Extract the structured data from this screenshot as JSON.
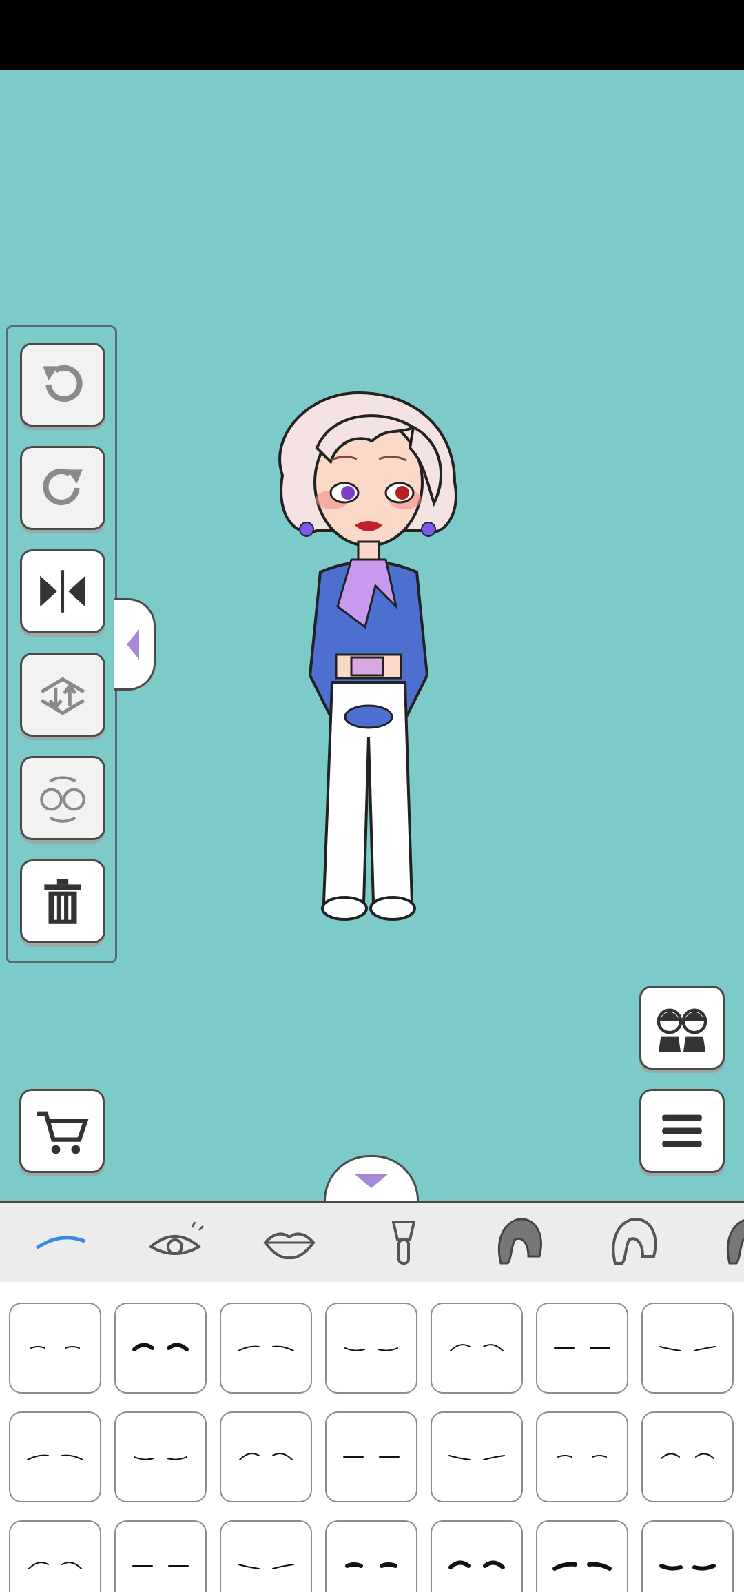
{
  "app": {
    "background_color": "#7ccbc8"
  },
  "tools": [
    {
      "name": "undo",
      "icon": "undo-icon"
    },
    {
      "name": "redo",
      "icon": "redo-icon"
    },
    {
      "name": "flip",
      "icon": "flip-icon"
    },
    {
      "name": "layer-order",
      "icon": "layer-swap-icon"
    },
    {
      "name": "swap-character",
      "icon": "character-swap-icon"
    },
    {
      "name": "delete",
      "icon": "trash-icon"
    }
  ],
  "buttons": {
    "cart_icon": "cart-icon",
    "menu_icon": "hamburger-icon",
    "characters_icon": "two-characters-icon",
    "collapse_icon": "chevron-down-icon",
    "panel_toggle_icon": "chevron-left-icon"
  },
  "categories": [
    {
      "name": "eyebrows",
      "icon": "eyebrow-icon",
      "selected": true
    },
    {
      "name": "eyes",
      "icon": "eye-icon",
      "selected": false
    },
    {
      "name": "lips",
      "icon": "lips-icon",
      "selected": false
    },
    {
      "name": "makeup",
      "icon": "brush-icon",
      "selected": false
    },
    {
      "name": "hair-color",
      "icon": "hair-filled-icon",
      "selected": false
    },
    {
      "name": "hair",
      "icon": "hair-outline-icon",
      "selected": false
    },
    {
      "name": "hair-more",
      "icon": "hair-partial-icon",
      "selected": false
    }
  ],
  "accent_color": "#3a8be0",
  "eyebrow_rows": 3,
  "eyebrow_columns": 7
}
